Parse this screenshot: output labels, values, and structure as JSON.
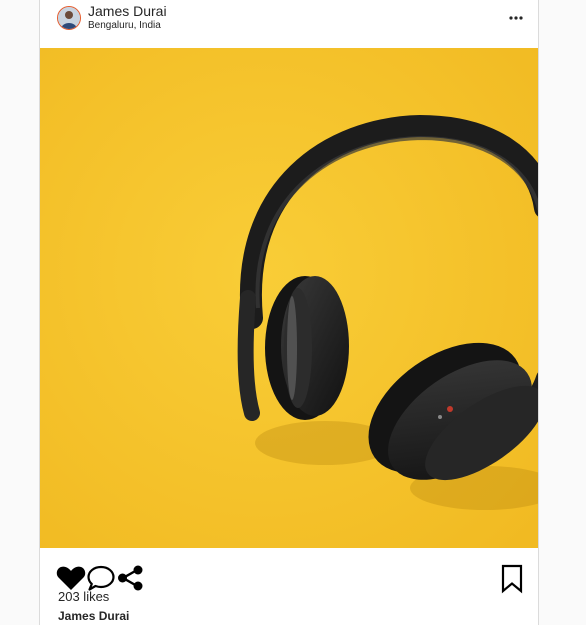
{
  "post": {
    "user_name": "James Durai",
    "location": "Bengaluru, India",
    "likes_text": "203 likes",
    "caption_user": "James Durai"
  },
  "icons": {
    "more": "more-options-icon",
    "like": "heart-icon",
    "comment": "comment-icon",
    "share": "share-icon",
    "save": "bookmark-icon"
  },
  "colors": {
    "photo_background": "#f6c42c",
    "avatar_ring": "#e65a2a",
    "text": "#262626"
  }
}
